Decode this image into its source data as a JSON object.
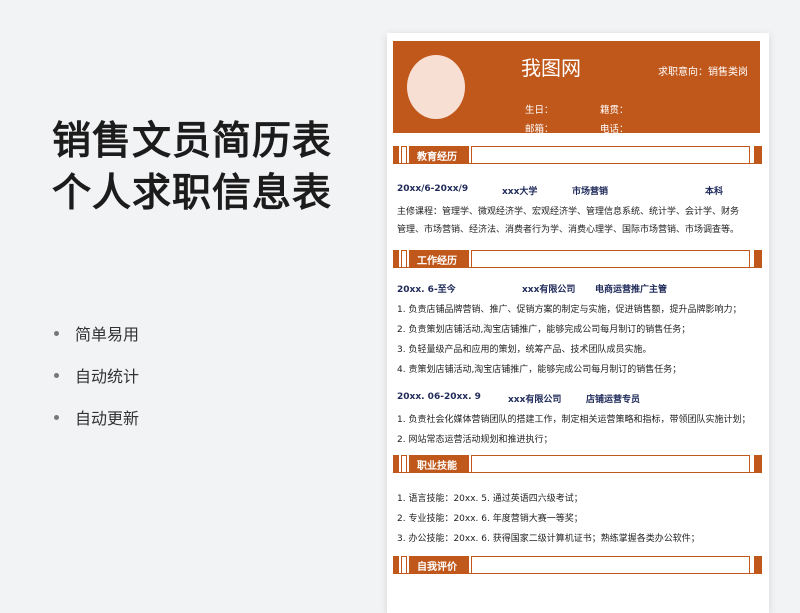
{
  "title": {
    "line1": "销售文员简历表",
    "line2": "个人求职信息表"
  },
  "features": [
    "简单易用",
    "自动统计",
    "自动更新"
  ],
  "resume": {
    "name": "我图网",
    "intent": "求职意向：销售类岗",
    "birthday_label": "生日：",
    "origin_label": "籍贯：",
    "email_label": "邮箱：",
    "phone_label": "电话：",
    "sections": {
      "education": "教育经历",
      "work": "工作经历",
      "skills": "职业技能",
      "self_eval": "自我评价"
    },
    "education": {
      "period": "20xx/6-20xx/9",
      "school": "xxx大学",
      "major": "市场营销",
      "degree": "本科",
      "courses_line1": "主修课程：管理学、微观经济学、宏观经济学、管理信息系统、统计学、会计学、财务",
      "courses_line2": "管理、市场营销、经济法、消费者行为学、消费心理学、国际市场营销、市场调查等。"
    },
    "work": [
      {
        "period": "20xx. 6-至今",
        "company": "xxx有限公司",
        "position": "电商运营推广主管",
        "items": [
          "1.  负责店铺品牌营销、推广、促销方案的制定与实施，促进销售额，提升品牌影响力；",
          "2.  负责策划店铺活动,淘宝店铺推广，能够完成公司每月制订的销售任务；",
          "3.  负轻量级产品和应用的策划，统筹产品、技术团队成员实施。",
          "4.  责策划店铺活动,淘宝店铺推广，能够完成公司每月制订的销售任务；"
        ]
      },
      {
        "period": "20xx. 06-20xx. 9",
        "company": "xxx有限公司",
        "position": "店铺运营专员",
        "items": [
          "1.  负责社会化媒体营销团队的搭建工作，制定相关运营策略和指标，带领团队实施计划；",
          "2.  网站常态运营活动规划和推进执行；"
        ]
      }
    ],
    "skills": [
      "1.  语言技能：20xx. 5. 通过英语四六级考试；",
      "2.  专业技能：20xx. 6. 年度营销大赛一等奖；",
      "3.  办公技能：20xx. 6. 获得国家二级计算机证书；熟练掌握各类办公软件；"
    ]
  },
  "colors": {
    "accent": "#c0571b",
    "avatar": "#f8dfd4",
    "job_text": "#1f2a5a"
  }
}
